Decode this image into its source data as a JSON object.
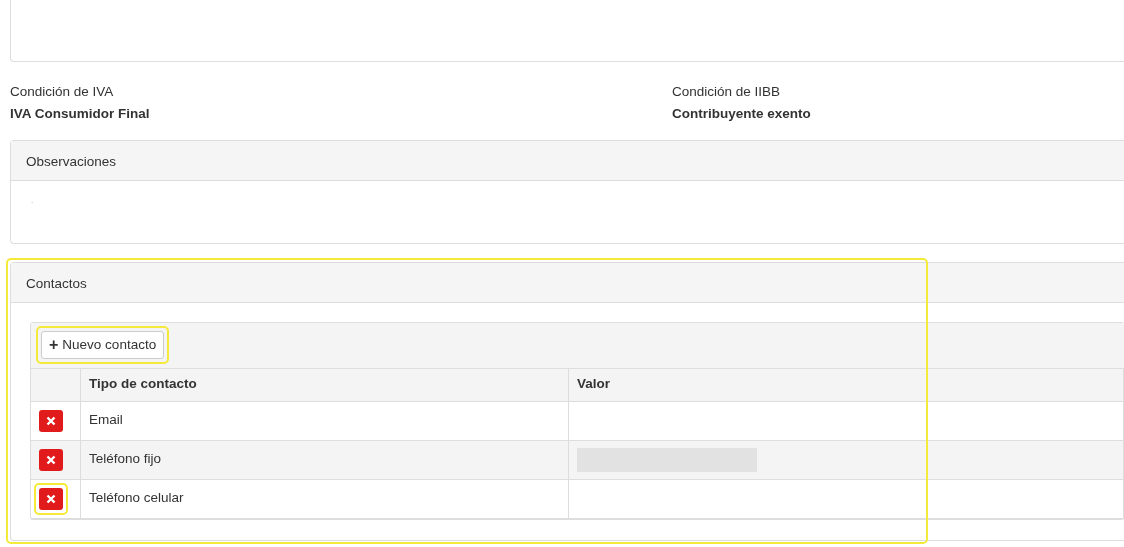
{
  "conditions": [
    {
      "label": "Condición de IVA",
      "value": "IVA Consumidor Final"
    },
    {
      "label": "Condición de IIBB",
      "value": "Contribuyente exento"
    }
  ],
  "observations": {
    "title": "Observaciones",
    "text": "."
  },
  "contacts": {
    "title": "Contactos",
    "highlighted": true,
    "new_button": {
      "icon": "+",
      "label": "Nuevo contacto",
      "highlighted": true
    },
    "columns": [
      "Tipo de contacto",
      "Valor"
    ],
    "rows": [
      {
        "type": "Email",
        "value_redacted": false,
        "delete_highlighted": false
      },
      {
        "type": "Teléfono fijo",
        "value_redacted": true,
        "delete_highlighted": false
      },
      {
        "type": "Teléfono celular",
        "value_redacted": false,
        "delete_highlighted": true
      }
    ]
  }
}
